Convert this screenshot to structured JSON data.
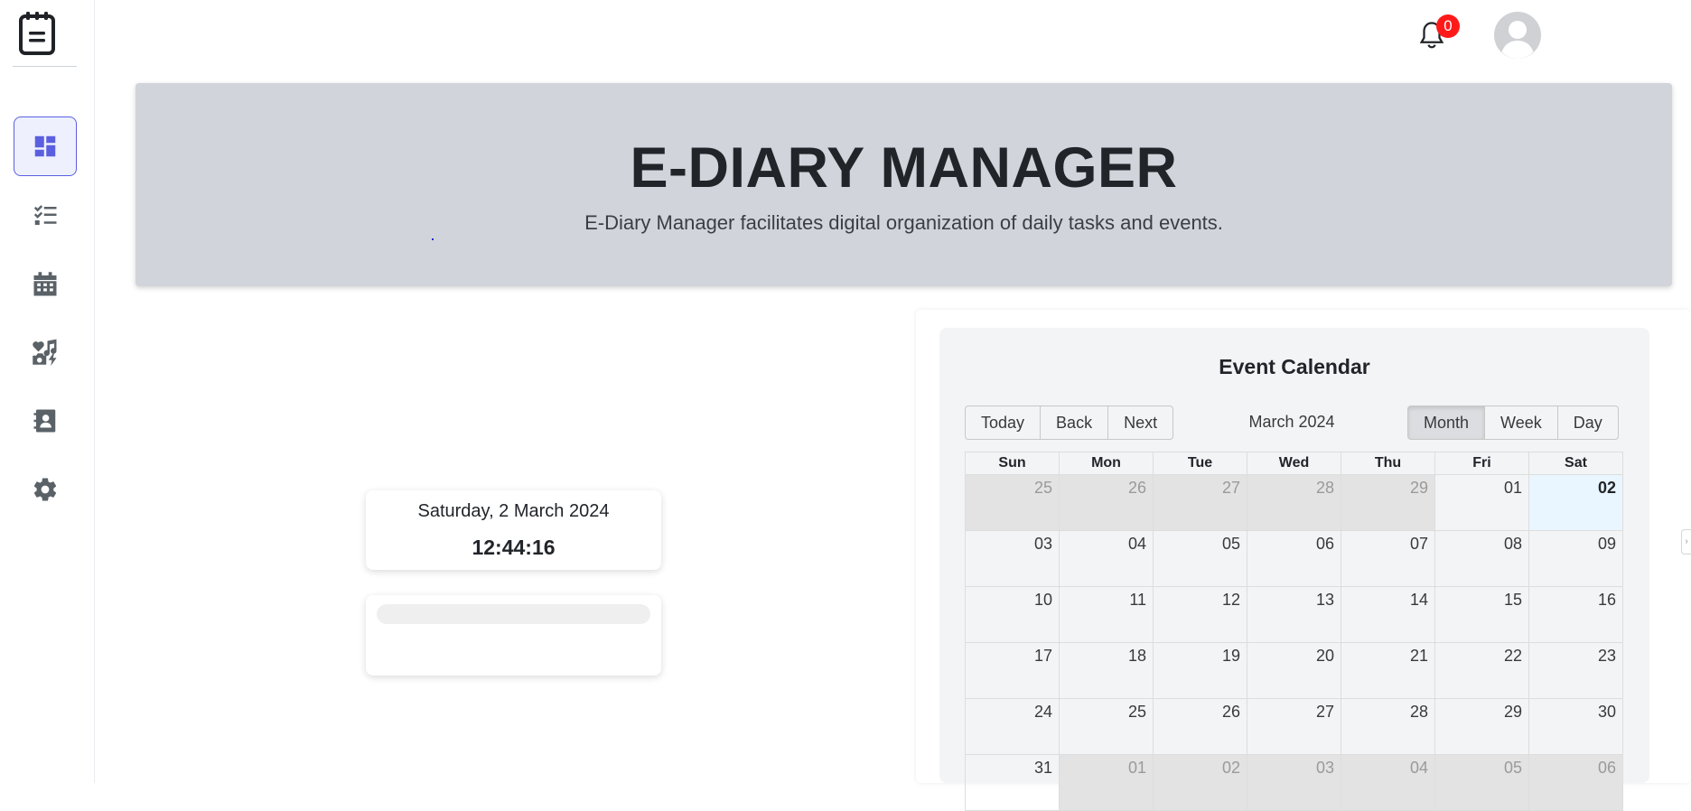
{
  "notifications": {
    "count": "0"
  },
  "hero": {
    "title": "E-DIARY MANAGER",
    "subtitle": "E-Diary Manager facilitates digital organization of daily tasks and events."
  },
  "clock": {
    "date": "Saturday, 2 March 2024",
    "time": "12:44:16"
  },
  "sidebar": {
    "items": [
      {
        "icon": "dashboard-icon",
        "active": true
      },
      {
        "icon": "task-list-icon",
        "active": false
      },
      {
        "icon": "calendar-icon",
        "active": false
      },
      {
        "icon": "hobbies-icon",
        "active": false
      },
      {
        "icon": "contacts-icon",
        "active": false
      },
      {
        "icon": "gear-icon",
        "active": false
      }
    ]
  },
  "calendar": {
    "title": "Event Calendar",
    "month_label": "March 2024",
    "nav_buttons": [
      "Today",
      "Back",
      "Next"
    ],
    "view_buttons": [
      "Month",
      "Week",
      "Day"
    ],
    "active_view": "Month",
    "weekdays": [
      "Sun",
      "Mon",
      "Tue",
      "Wed",
      "Thu",
      "Fri",
      "Sat"
    ],
    "weeks": [
      [
        {
          "d": "25",
          "off": true
        },
        {
          "d": "26",
          "off": true
        },
        {
          "d": "27",
          "off": true
        },
        {
          "d": "28",
          "off": true
        },
        {
          "d": "29",
          "off": true
        },
        {
          "d": "01"
        },
        {
          "d": "02",
          "today": true
        }
      ],
      [
        {
          "d": "03"
        },
        {
          "d": "04"
        },
        {
          "d": "05"
        },
        {
          "d": "06"
        },
        {
          "d": "07"
        },
        {
          "d": "08"
        },
        {
          "d": "09"
        }
      ],
      [
        {
          "d": "10"
        },
        {
          "d": "11"
        },
        {
          "d": "12"
        },
        {
          "d": "13"
        },
        {
          "d": "14"
        },
        {
          "d": "15"
        },
        {
          "d": "16"
        }
      ],
      [
        {
          "d": "17"
        },
        {
          "d": "18"
        },
        {
          "d": "19"
        },
        {
          "d": "20"
        },
        {
          "d": "21"
        },
        {
          "d": "22"
        },
        {
          "d": "23"
        }
      ],
      [
        {
          "d": "24"
        },
        {
          "d": "25"
        },
        {
          "d": "26"
        },
        {
          "d": "27"
        },
        {
          "d": "28"
        },
        {
          "d": "29"
        },
        {
          "d": "30"
        }
      ],
      [
        {
          "d": "31"
        },
        {
          "d": "01",
          "off": true
        },
        {
          "d": "02",
          "off": true
        },
        {
          "d": "03",
          "off": true
        },
        {
          "d": "04",
          "off": true
        },
        {
          "d": "05",
          "off": true
        },
        {
          "d": "06",
          "off": true
        }
      ]
    ]
  },
  "colors": {
    "accent": "#5b5fdf",
    "hero_bg": "#d1d4da",
    "badge": "#ff1a1a",
    "today_bg": "#eaf6ff"
  }
}
